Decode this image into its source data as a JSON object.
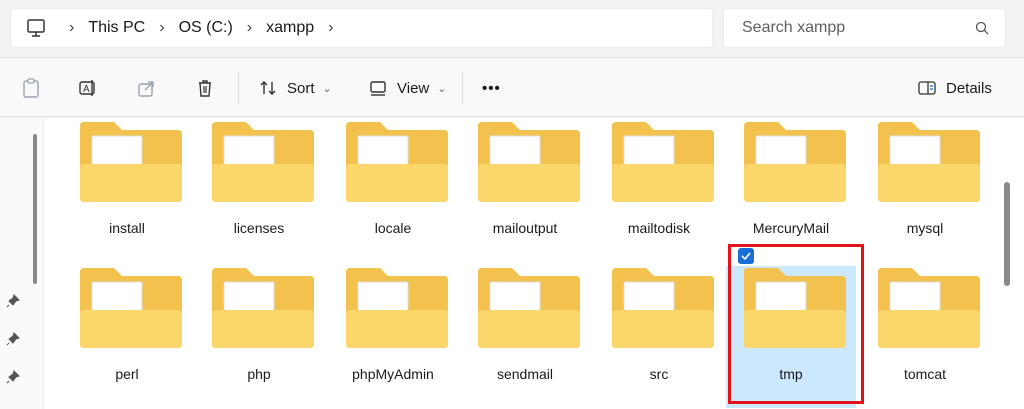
{
  "breadcrumb": {
    "items": [
      "This PC",
      "OS (C:)",
      "xampp"
    ]
  },
  "search": {
    "placeholder": "Search xampp"
  },
  "toolbar": {
    "sort_label": "Sort",
    "view_label": "View",
    "more_label": "•••",
    "details_label": "Details"
  },
  "folders": {
    "row1": [
      {
        "name": "install"
      },
      {
        "name": "licenses"
      },
      {
        "name": "locale"
      },
      {
        "name": "mailoutput"
      },
      {
        "name": "mailtodisk"
      },
      {
        "name": "MercuryMail"
      },
      {
        "name": "mysql"
      }
    ],
    "row2": [
      {
        "name": "perl"
      },
      {
        "name": "php"
      },
      {
        "name": "phpMyAdmin"
      },
      {
        "name": "sendmail"
      },
      {
        "name": "src"
      },
      {
        "name": "tmp",
        "selected": true
      },
      {
        "name": "tomcat"
      }
    ]
  },
  "colors": {
    "folder_back": "#f2c14e",
    "folder_front": "#fbd66a",
    "selection_bg": "#cce8ff",
    "highlight_border": "#e0131b",
    "check_blue": "#1a6fd6"
  }
}
